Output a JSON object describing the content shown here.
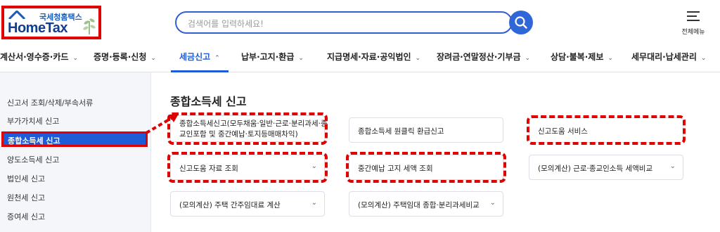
{
  "logo": {
    "korean": "국세청홈택스",
    "english": "HomeTax"
  },
  "search": {
    "placeholder": "검색어를 입력하세요!"
  },
  "header": {
    "menu_label": "전체메뉴"
  },
  "gnb": [
    {
      "label": "계산서·영수증·카드"
    },
    {
      "label": "증명·등록·신청"
    },
    {
      "label": "세금신고",
      "active": true
    },
    {
      "label": "납부·고지·환급"
    },
    {
      "label": "지급명세·자료·공익법인"
    },
    {
      "label": "장려금·연말정산·기부금"
    },
    {
      "label": "상담·불복·제보"
    },
    {
      "label": "세무대리·납세관리"
    }
  ],
  "sidebar": {
    "items": [
      {
        "label": "신고서 조회/삭제/부속서류"
      },
      {
        "label": "부가가치세 신고"
      },
      {
        "label": "종합소득세 신고",
        "active": true
      },
      {
        "label": "양도소득세 신고"
      },
      {
        "label": "법인세 신고"
      },
      {
        "label": "원천세 신고"
      },
      {
        "label": "증여세 신고"
      }
    ]
  },
  "main": {
    "title": "종합소득세 신고",
    "cards": [
      {
        "label": "종합소득세신고(모두채움·일반·근로·분리과세·종교인포함 및 중간예납·토지등매매차익)"
      },
      {
        "label": "종합소득세 원클릭 환급신고"
      },
      {
        "label": "신고도움 서비스"
      },
      {
        "label": "신고도움 자료 조회"
      },
      {
        "label": "중간예납 고지 세액 조회"
      },
      {
        "label": "(모의계산) 근로·종교인소득 세액비교"
      },
      {
        "label": "(모의계산) 주택 간주임대료 계산"
      },
      {
        "label": "(모의계산) 주택임대 종합·분리과세비교"
      }
    ]
  },
  "colors": {
    "brand": "#1d5bd8",
    "highlight": "#e00000",
    "sidebar_bg": "#f4f6fa"
  }
}
